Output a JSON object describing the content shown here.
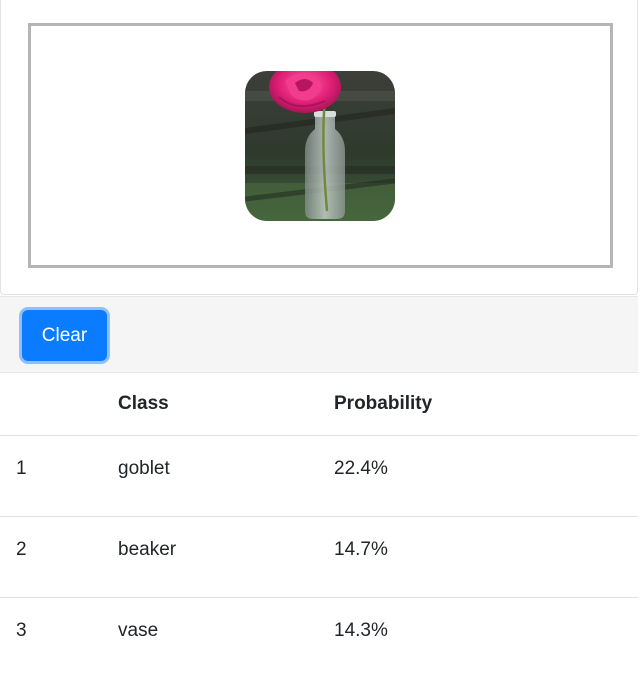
{
  "image": {
    "alt_icon": "uploaded-image-rose-in-vase"
  },
  "toolbar": {
    "clear_label": "Clear"
  },
  "results": {
    "headers": [
      "",
      "Class",
      "Probability"
    ],
    "rows": [
      {
        "rank": "1",
        "class": "goblet",
        "probability": "22.4%"
      },
      {
        "rank": "2",
        "class": "beaker",
        "probability": "14.7%"
      },
      {
        "rank": "3",
        "class": "vase",
        "probability": "14.3%"
      }
    ]
  },
  "colors": {
    "button": "#0b7bff",
    "button_ring": "#8cc0ff",
    "toolbar_bg": "#f5f5f5",
    "dropzone_border": "#b5b5b5"
  }
}
